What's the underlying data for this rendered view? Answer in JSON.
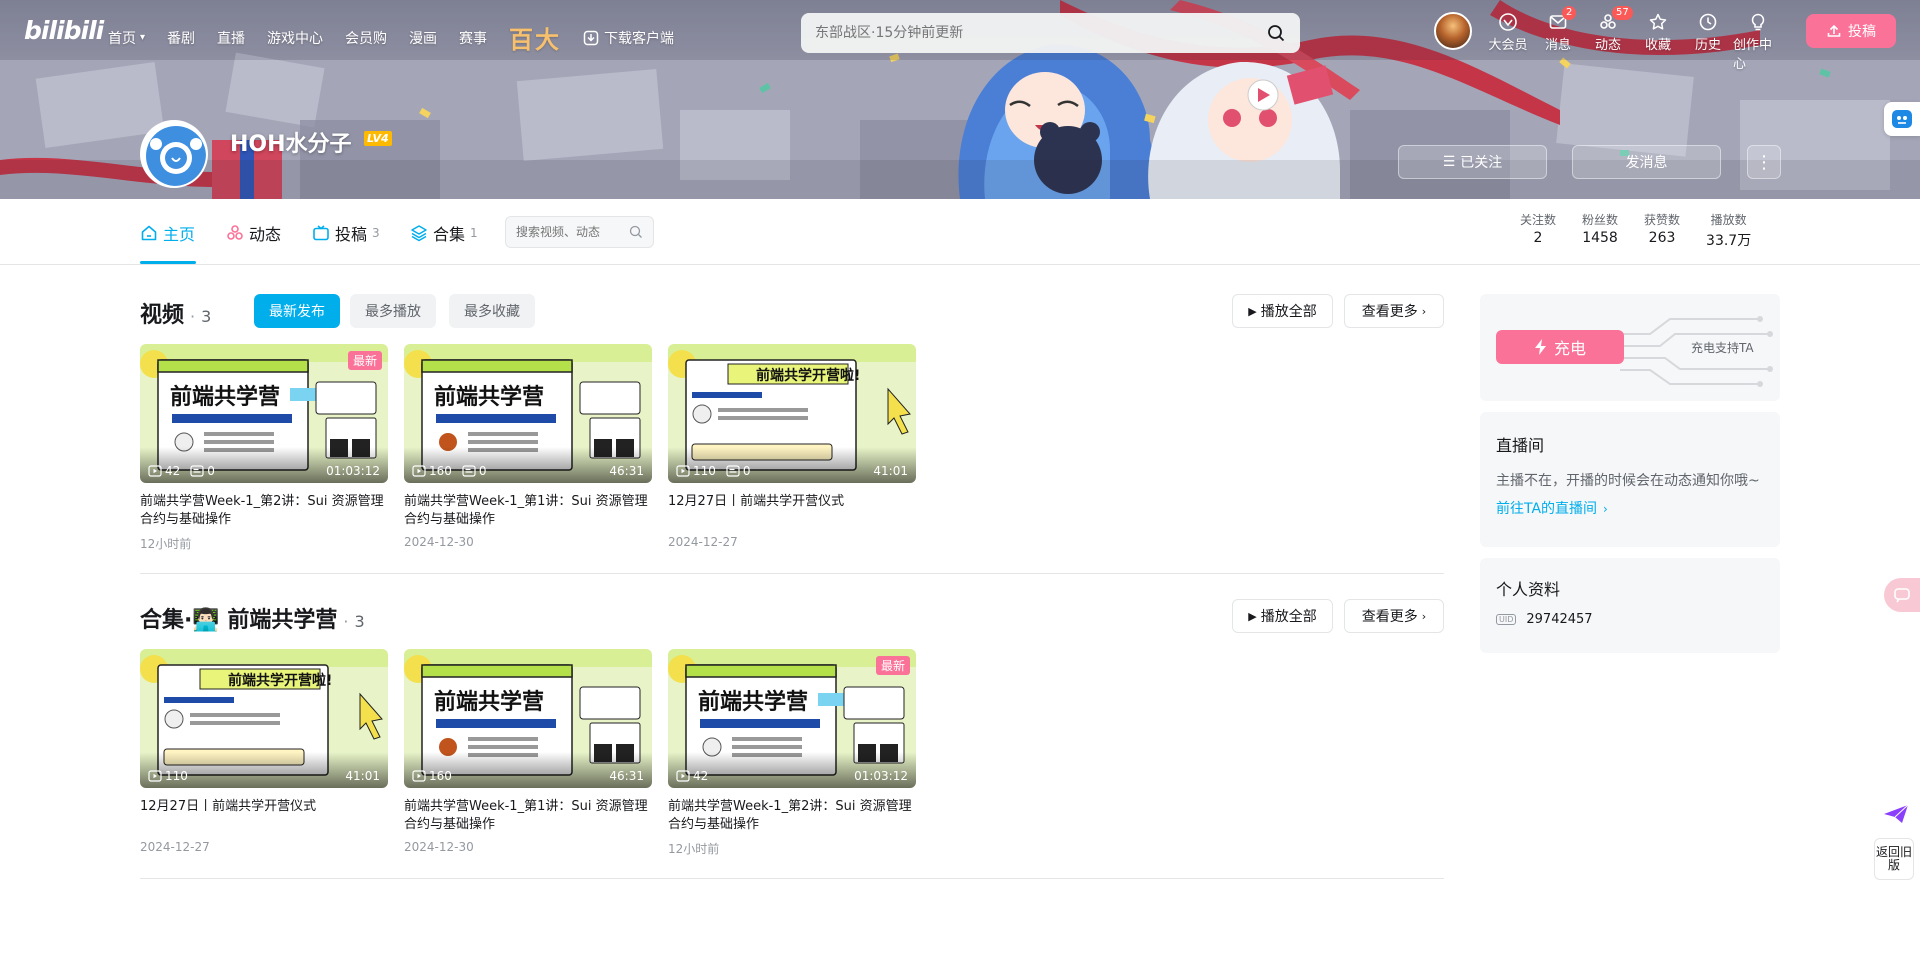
{
  "header": {
    "logo": "bilibili",
    "nav": [
      "首页",
      "番剧",
      "直播",
      "游戏中心",
      "会员购",
      "漫画",
      "赛事"
    ],
    "baida": "百大",
    "download": "下载客户端",
    "search_placeholder": "东部战区·15分钟前更新",
    "right_icons": [
      {
        "label": "大会员",
        "icon": "vip-icon",
        "badge": ""
      },
      {
        "label": "消息",
        "icon": "message-icon",
        "badge": "2"
      },
      {
        "label": "动态",
        "icon": "dynamic-icon",
        "badge": "57"
      },
      {
        "label": "收藏",
        "icon": "star-icon",
        "badge": ""
      },
      {
        "label": "历史",
        "icon": "clock-icon",
        "badge": ""
      },
      {
        "label": "创作中心",
        "icon": "bulb-icon",
        "badge": ""
      }
    ],
    "upload": "投稿"
  },
  "profile": {
    "name": "HOH水分子",
    "level": "LV4",
    "follow": "已关注",
    "message": "发消息",
    "more": "⋮"
  },
  "tabs": [
    {
      "label": "主页",
      "count": "",
      "icon": "home-icon",
      "active": true
    },
    {
      "label": "动态",
      "count": "",
      "icon": "dynamic-icon",
      "active": false
    },
    {
      "label": "投稿",
      "count": "3",
      "icon": "tv-icon",
      "active": false
    },
    {
      "label": "合集",
      "count": "1",
      "icon": "layers-icon",
      "active": false
    }
  ],
  "tab_search_placeholder": "搜索视频、动态",
  "stats": [
    {
      "label": "关注数",
      "value": "2"
    },
    {
      "label": "粉丝数",
      "value": "1458"
    },
    {
      "label": "获赞数",
      "value": "263"
    },
    {
      "label": "播放数",
      "value": "33.7万"
    }
  ],
  "videos": {
    "title": "视频",
    "count": "3",
    "filters": [
      "最新发布",
      "最多播放",
      "最多收藏"
    ],
    "play_all": "播放全部",
    "see_more": "查看更多",
    "items": [
      {
        "title": "前端共学营Week-1_第2讲：Sui 资源管理合约与基础操作",
        "date": "12小时前",
        "plays": "42",
        "danmaku": "0",
        "duration": "01:03:12",
        "tag": "最新",
        "variant": "a"
      },
      {
        "title": "前端共学营Week-1_第1讲：Sui 资源管理合约与基础操作",
        "date": "2024-12-30",
        "plays": "160",
        "danmaku": "0",
        "duration": "46:31",
        "tag": "",
        "variant": "b"
      },
      {
        "title": "12月27日丨前端共学开营仪式",
        "date": "2024-12-27",
        "plays": "110",
        "danmaku": "0",
        "duration": "41:01",
        "tag": "",
        "variant": "c"
      }
    ]
  },
  "collection": {
    "title": "合集·👨🏻‍💻 前端共学营",
    "count": "3",
    "play_all": "播放全部",
    "see_more": "查看更多",
    "items": [
      {
        "title": "12月27日丨前端共学开营仪式",
        "date": "2024-12-27",
        "plays": "110",
        "duration": "41:01",
        "tag": "",
        "variant": "c"
      },
      {
        "title": "前端共学营Week-1_第1讲：Sui 资源管理合约与基础操作",
        "date": "2024-12-30",
        "plays": "160",
        "duration": "46:31",
        "tag": "",
        "variant": "b"
      },
      {
        "title": "前端共学营Week-1_第2讲：Sui 资源管理合约与基础操作",
        "date": "12小时前",
        "plays": "42",
        "duration": "01:03:12",
        "tag": "最新",
        "variant": "a"
      }
    ]
  },
  "sidebar": {
    "charge": "充电",
    "charge_text": "充电支持TA",
    "live_title": "直播间",
    "live_text": "主播不在，开播的时候会在动态通知你哦~",
    "live_link": "前往TA的直播间",
    "info_title": "个人资料",
    "uid_label": "UID",
    "uid": "29742457"
  },
  "float": {
    "back_old": "返回旧版"
  },
  "colors": {
    "accent": "#00aeec",
    "pink": "#fb7299",
    "text": "#18191c",
    "muted": "#9499a0"
  }
}
